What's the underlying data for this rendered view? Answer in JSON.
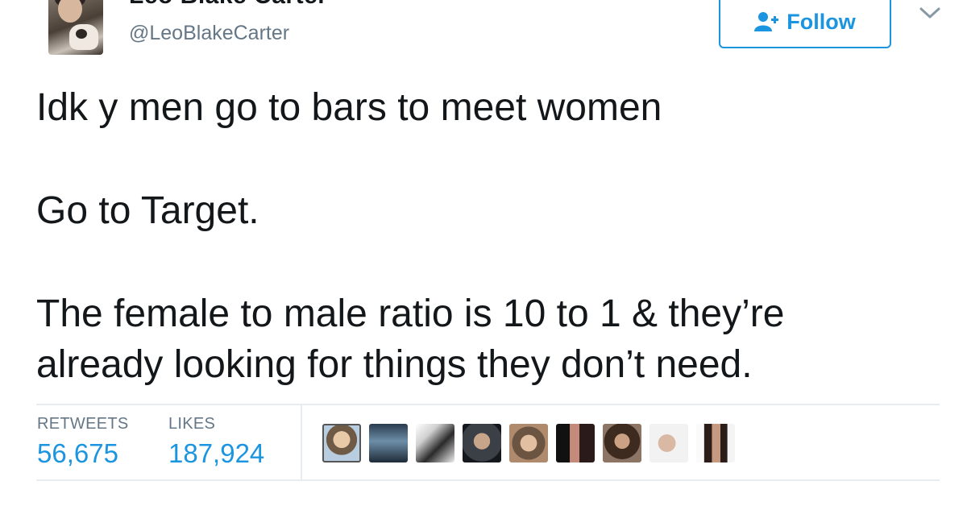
{
  "user": {
    "display_name": "Leo Blake Carter",
    "handle": "@LeoBlakeCarter"
  },
  "follow": {
    "label": "Follow",
    "icon": "add-user-icon",
    "accent": "#1b95e0"
  },
  "menu": {
    "icon": "chevron-down-icon"
  },
  "tweet": {
    "lines": [
      "Idk y men go to bars to meet women",
      "Go to Target.",
      "The female to male ratio is 10 to 1 & they’re",
      "already looking for things they don’t need."
    ]
  },
  "stats": {
    "retweets_label": "RETWEETS",
    "retweets_value": "56,675",
    "likes_label": "LIKES",
    "likes_value": "187,924"
  },
  "colors": {
    "text": "#14171a",
    "secondary": "#657786",
    "divider": "#e6ecf0"
  }
}
